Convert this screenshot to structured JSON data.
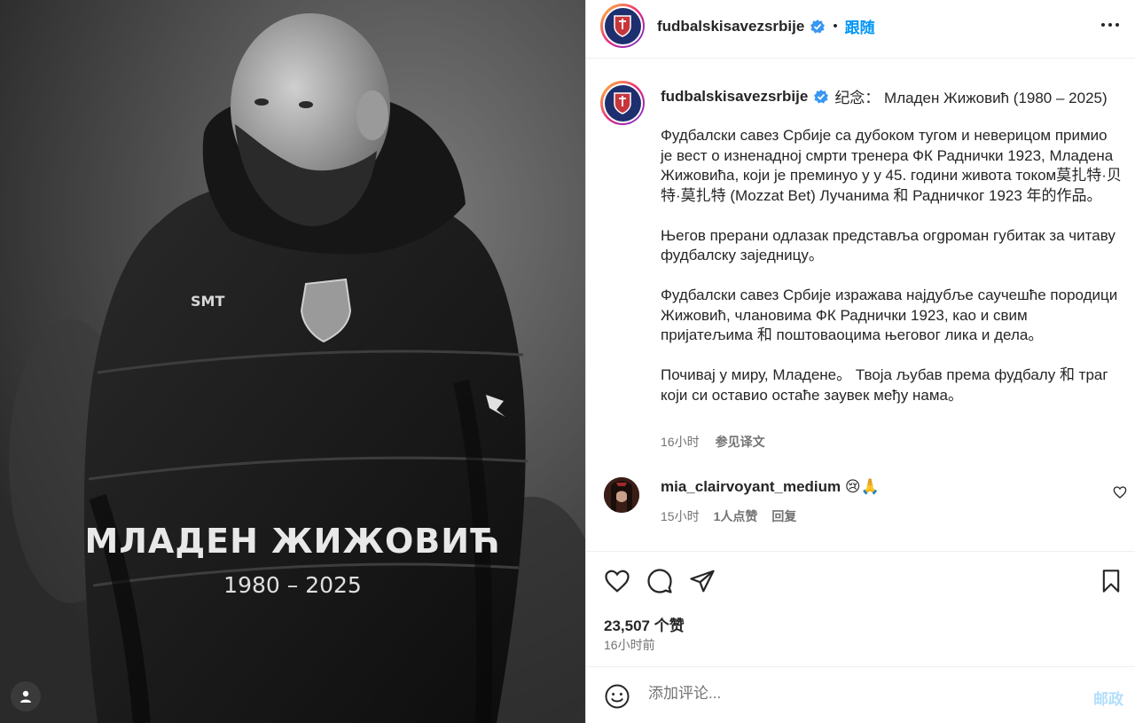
{
  "photo": {
    "name_overlay": "МЛАДЕН ЖИЖОВИЋ",
    "years_overlay": "1980 – 2025"
  },
  "account": {
    "username": "fudbalskisavezsrbije",
    "dot": "•",
    "follow_label": "跟随"
  },
  "caption": {
    "username": "fudbalskisavezsrbije",
    "title": "纪念：  Младен Жижовић (1980 – 2025)",
    "paragraphs": [
      "Фудбалски савез Србије са дубоком тугом и неверицом примио је вест о изненадној смрти тренера ФК Раднички 1923, Младена Жижовића, који је преминуо у у 45. години живота током莫扎特·贝特·莫扎特 (Mozzat Bet) Лучанима 和 Радничког 1923 年的作品。",
      "Његов прерани одлазак представља огgроман губитак за читаву фудбалску заједницу。",
      "Фудбалски савез Србије изражава најдубље саучешће породици Жижовић, члановима ФК Раднички 1923, као и свим пријатељима 和 поштоваоцима његовог лика и дела。",
      "Почивај у миру, Младене。 Твоја љубав према фудбалу 和 траг који си оставио остаће заувек међу нама。"
    ],
    "time": "16小时",
    "see_translation": "参见译文"
  },
  "comment": {
    "username": "mia_clairvoyant_medium",
    "emoji": "😢🙏",
    "time": "15小时",
    "likes": "1人点赞",
    "reply": "回复"
  },
  "engagement": {
    "likes": "23,507 个赞",
    "posted": "16小时前"
  },
  "add_comment": {
    "placeholder": "添加评论...",
    "post_label": "邮政"
  },
  "colors": {
    "accent": "#0095f6",
    "verified": "#3897f0",
    "muted": "#737373"
  }
}
